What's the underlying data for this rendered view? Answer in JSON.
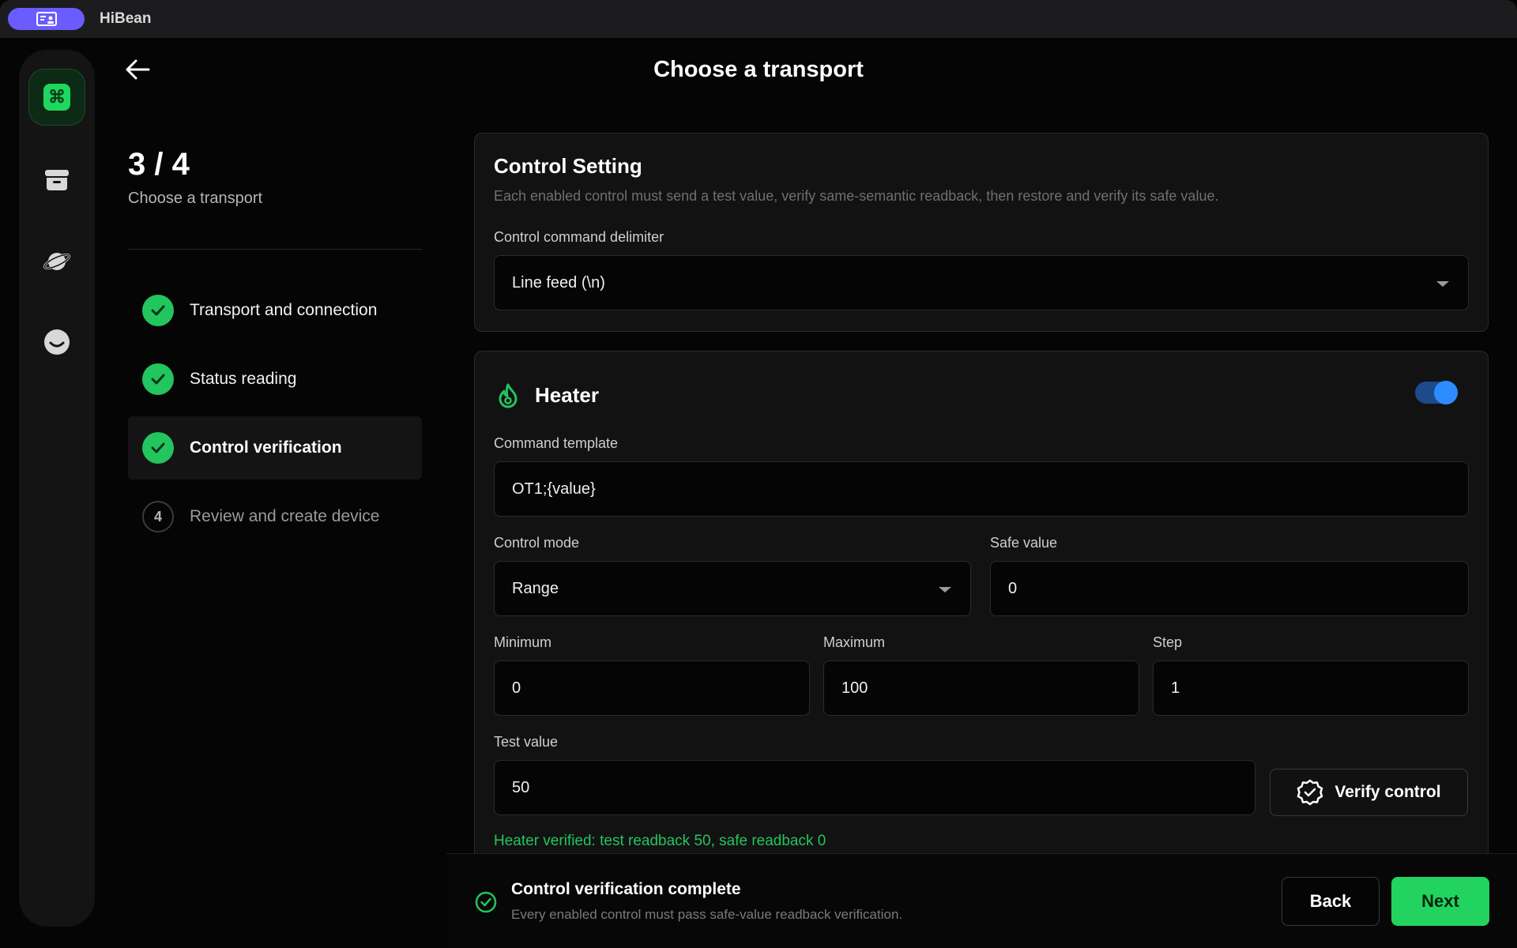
{
  "app": {
    "title": "HiBean"
  },
  "header": {
    "title": "Choose a transport"
  },
  "progress": {
    "count": "3 / 4",
    "subtitle": "Choose a transport",
    "steps": [
      {
        "label": "Transport and connection",
        "state": "complete"
      },
      {
        "label": "Status reading",
        "state": "complete"
      },
      {
        "label": "Control verification",
        "state": "complete"
      },
      {
        "label": "Review and create device",
        "state": "pending",
        "number": "4"
      }
    ]
  },
  "sidebar": {
    "items": [
      {
        "icon": "command-icon",
        "active": true
      },
      {
        "icon": "archive-icon",
        "active": false
      },
      {
        "icon": "planet-icon",
        "active": false
      },
      {
        "icon": "smile-icon",
        "active": false
      }
    ]
  },
  "control_setting": {
    "title": "Control Setting",
    "description": "Each enabled control must send a test value, verify same-semantic readback, then restore and verify its safe value.",
    "delimiter_label": "Control command delimiter",
    "delimiter_value": "Line feed (\\n)"
  },
  "heater": {
    "title": "Heater",
    "enabled": true,
    "command_template_label": "Command template",
    "command_template_value": "OT1;{value}",
    "control_mode_label": "Control mode",
    "control_mode_value": "Range",
    "safe_value_label": "Safe value",
    "safe_value": "0",
    "minimum_label": "Minimum",
    "minimum_value": "0",
    "maximum_label": "Maximum",
    "maximum_value": "100",
    "step_label": "Step",
    "step_value": "1",
    "test_value_label": "Test value",
    "test_value": "50",
    "verify_button": "Verify control",
    "verified_message": "Heater verified: test readback 50, safe readback 0"
  },
  "footer": {
    "status_title": "Control verification complete",
    "status_subtitle": "Every enabled control must pass safe-value readback verification.",
    "back_label": "Back",
    "next_label": "Next"
  },
  "colors": {
    "accent_green": "#22c55e",
    "toggle_blue": "#2d8cff",
    "app_purple": "#6b5cff"
  }
}
